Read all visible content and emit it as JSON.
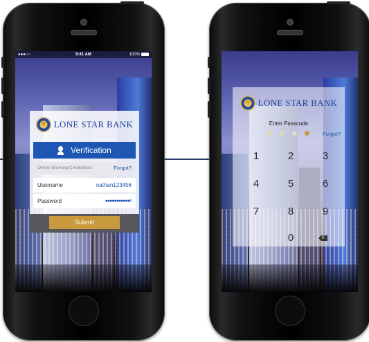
{
  "status_bar": {
    "signal": "●●●○○",
    "time": "9:41 AM",
    "battery": "100%"
  },
  "brand": {
    "name": "LONE STAR BANK"
  },
  "login": {
    "header_label": "Verification",
    "section_label": "Online Banking Credentials",
    "forgot_label": "Forgot?",
    "username_label": "Username",
    "username_value": "nathan123456",
    "password_label": "Password",
    "password_value": "●●●●●●●●●●●n",
    "submit_label": "Submit"
  },
  "passcode": {
    "title": "Enter Passcode",
    "forgot_label": "Forgot?",
    "dots_filled": 1,
    "keys": [
      "1",
      "2",
      "3",
      "4",
      "5",
      "6",
      "7",
      "8",
      "9",
      "0"
    ],
    "delete_label": "X"
  },
  "colors": {
    "brand_blue": "#1d56b3",
    "gold": "#c89a3d",
    "connector": "#2b3a6b"
  }
}
